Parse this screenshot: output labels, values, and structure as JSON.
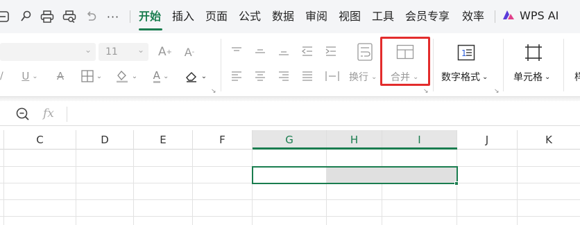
{
  "menu_tabs": [
    "开始",
    "插入",
    "页面",
    "公式",
    "数据",
    "审阅",
    "视图",
    "工具",
    "会员专享",
    "效率"
  ],
  "wps_ai_label": "WPS AI",
  "quick_access_icons": [
    "page-icon",
    "paint-brush-icon",
    "print-icon",
    "print-preview-icon",
    "undo-icon",
    "more-icon"
  ],
  "font": {
    "name": "",
    "size": "11"
  },
  "align": {
    "wrap_label": "换行",
    "merge_label": "合并",
    "number_format_label": "数字格式",
    "cell_label": "单元格",
    "next_group_partial": "样"
  },
  "formula_bar": {
    "fx_label": "fx",
    "value": ""
  },
  "columns": [
    "C",
    "D",
    "E",
    "F",
    "G",
    "H",
    "I",
    "J",
    "K"
  ],
  "selected_columns": [
    "G",
    "H",
    "I"
  ],
  "colors": {
    "accent": "#1a7d4f",
    "highlight": "#e32c2c",
    "selection_fill": "#e0e0e0"
  }
}
